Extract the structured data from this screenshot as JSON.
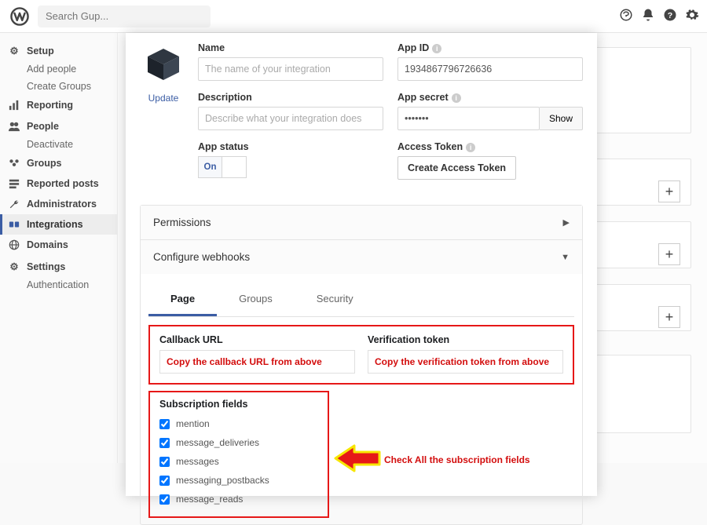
{
  "topbar": {
    "search_placeholder": "Search Gup..."
  },
  "sidebar": {
    "setup": {
      "head": "Setup",
      "add_people": "Add people",
      "create_groups": "Create Groups"
    },
    "reporting": "Reporting",
    "people": {
      "head": "People",
      "deactivate": "Deactivate"
    },
    "groups": "Groups",
    "reported": "Reported posts",
    "admins": "Administrators",
    "integrations": "Integrations",
    "domains": "Domains",
    "settings": {
      "head": "Settings",
      "auth": "Authentication"
    }
  },
  "form": {
    "update_link": "Update",
    "name_label": "Name",
    "name_placeholder": "The name of your integration",
    "desc_label": "Description",
    "desc_placeholder": "Describe what your integration does",
    "status_label": "App status",
    "status_on": "On",
    "appid_label": "App ID",
    "appid_value": "1934867796726636",
    "secret_label": "App secret",
    "secret_value": "•••••••",
    "show_btn": "Show",
    "token_label": "Access Token",
    "token_btn": "Create Access Token"
  },
  "acc": {
    "permissions": "Permissions",
    "webhooks": "Configure webhooks"
  },
  "tabs": {
    "page": "Page",
    "groups": "Groups",
    "security": "Security"
  },
  "callback": {
    "url_label": "Callback URL",
    "url_value": "Copy the callback URL from above",
    "token_label": "Verification token",
    "token_value": "Copy the verification token from above"
  },
  "subs": {
    "title": "Subscription fields",
    "items": [
      "mention",
      "message_deliveries",
      "messages",
      "messaging_postbacks",
      "message_reads"
    ]
  },
  "annot": {
    "text": "Check All the subscription fields"
  }
}
